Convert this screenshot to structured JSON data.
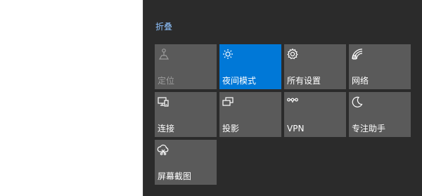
{
  "action_center": {
    "collapse_label": "折叠",
    "tiles": [
      {
        "label": "定位",
        "icon": "location-icon",
        "state": "disabled"
      },
      {
        "label": "夜间模式",
        "icon": "night-light-icon",
        "state": "on"
      },
      {
        "label": "所有设置",
        "icon": "gear-icon",
        "state": "off"
      },
      {
        "label": "网络",
        "icon": "network-icon",
        "state": "off"
      },
      {
        "label": "连接",
        "icon": "connect-icon",
        "state": "off"
      },
      {
        "label": "投影",
        "icon": "project-icon",
        "state": "off"
      },
      {
        "label": "VPN",
        "icon": "vpn-icon",
        "state": "off"
      },
      {
        "label": "专注助手",
        "icon": "focus-assist-icon",
        "state": "off"
      },
      {
        "label": "屏幕截图",
        "icon": "screen-snip-icon",
        "state": "off"
      }
    ]
  },
  "colors": {
    "panel_background": "#2b2b2b",
    "tile_background": "#5a5a5a",
    "tile_active": "#0078d7",
    "link_text": "#8fc3ff",
    "tile_disabled_text": "#9c9c9c"
  }
}
